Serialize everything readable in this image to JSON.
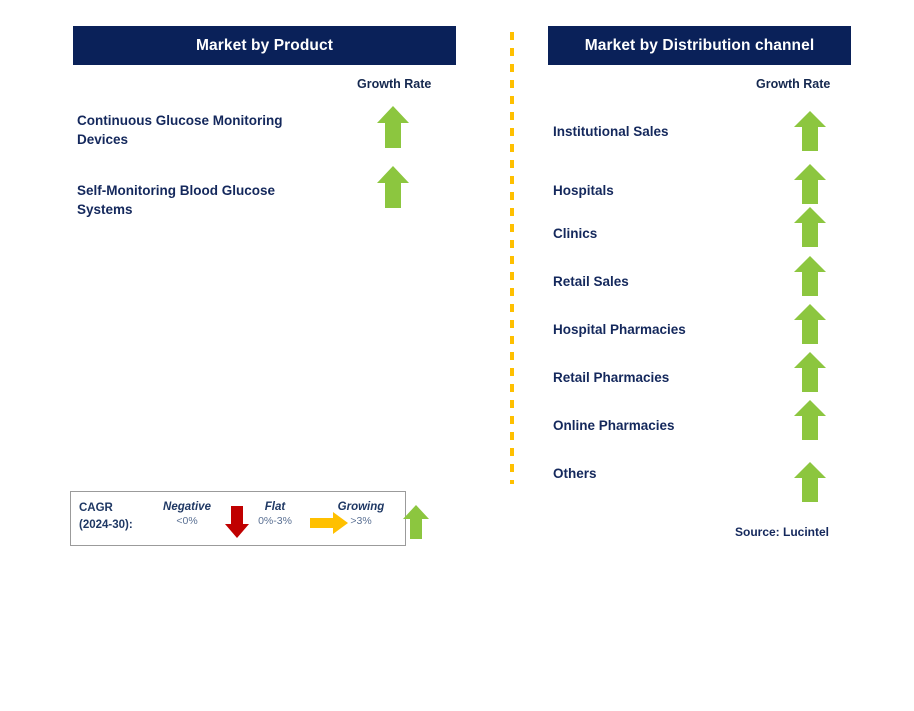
{
  "sections": {
    "product": {
      "title": "Market by Product",
      "growth_rate_header": "Growth Rate",
      "items": [
        {
          "label": "Continuous Glucose Monitoring Devices",
          "growth": "growing",
          "icon": "arrow-up-icon"
        },
        {
          "label": "Self-Monitoring Blood Glucose Systems",
          "growth": "growing",
          "icon": "arrow-up-icon"
        }
      ]
    },
    "distribution": {
      "title": "Market by Distribution channel",
      "growth_rate_header": "Growth Rate",
      "items": [
        {
          "label": "Institutional Sales",
          "growth": "growing",
          "icon": "arrow-up-icon"
        },
        {
          "label": "Hospitals",
          "growth": "growing",
          "icon": "arrow-up-icon"
        },
        {
          "label": "Clinics",
          "growth": "growing",
          "icon": "arrow-up-icon"
        },
        {
          "label": "Retail Sales",
          "growth": "growing",
          "icon": "arrow-up-icon"
        },
        {
          "label": "Hospital Pharmacies",
          "growth": "growing",
          "icon": "arrow-up-icon"
        },
        {
          "label": "Retail Pharmacies",
          "growth": "growing",
          "icon": "arrow-up-icon"
        },
        {
          "label": "Online Pharmacies",
          "growth": "growing",
          "icon": "arrow-up-icon"
        },
        {
          "label": "Others",
          "growth": "growing",
          "icon": "arrow-up-icon"
        }
      ]
    }
  },
  "legend": {
    "cagr_label": "CAGR (2024-30):",
    "entries": [
      {
        "name": "Negative",
        "range": "<0%",
        "icon": "arrow-down-icon",
        "color": "#C00000"
      },
      {
        "name": "Flat",
        "range": "0%-3%",
        "icon": "arrow-right-icon",
        "color": "#FFC000"
      },
      {
        "name": "Growing",
        "range": ">3%",
        "icon": "arrow-up-icon",
        "color": "#8CC63F"
      }
    ]
  },
  "source": "Source: Lucintel",
  "colors": {
    "header_navy": "#0A2159",
    "label_navy": "#14285C",
    "growth_green": "#8CC63F",
    "negative_red": "#C00000",
    "flat_yellow": "#FFC000",
    "divider_yellow": "#FFC000",
    "legend_border": "#9B9B9B"
  },
  "chart_data": {
    "type": "table",
    "title": "Market Segmentation Growth Outlook",
    "legend_position": "bottom-left",
    "categories": [
      "Continuous Glucose Monitoring Devices",
      "Self-Monitoring Blood Glucose Systems",
      "Institutional Sales",
      "Hospitals",
      "Clinics",
      "Retail Sales",
      "Hospital Pharmacies",
      "Retail Pharmacies",
      "Online Pharmacies",
      "Others"
    ],
    "values": [
      "growing",
      "growing",
      "growing",
      "growing",
      "growing",
      "growing",
      "growing",
      "growing",
      "growing",
      "growing"
    ],
    "series": [
      {
        "name": "Market by Product",
        "categories": [
          "Continuous Glucose Monitoring Devices",
          "Self-Monitoring Blood Glucose Systems"
        ],
        "values": [
          "growing",
          "growing"
        ]
      },
      {
        "name": "Market by Distribution channel",
        "categories": [
          "Institutional Sales",
          "Hospitals",
          "Clinics",
          "Retail Sales",
          "Hospital Pharmacies",
          "Retail Pharmacies",
          "Online Pharmacies",
          "Others"
        ],
        "values": [
          "growing",
          "growing",
          "growing",
          "growing",
          "growing",
          "growing",
          "growing",
          "growing"
        ]
      }
    ],
    "value_scale": {
      "negative": "<0%",
      "flat": "0%-3%",
      "growing": ">3%"
    },
    "xlabel": "Growth Rate",
    "ylabel": "",
    "annotations": [
      "Source: Lucintel",
      "CAGR (2024-30):"
    ]
  }
}
